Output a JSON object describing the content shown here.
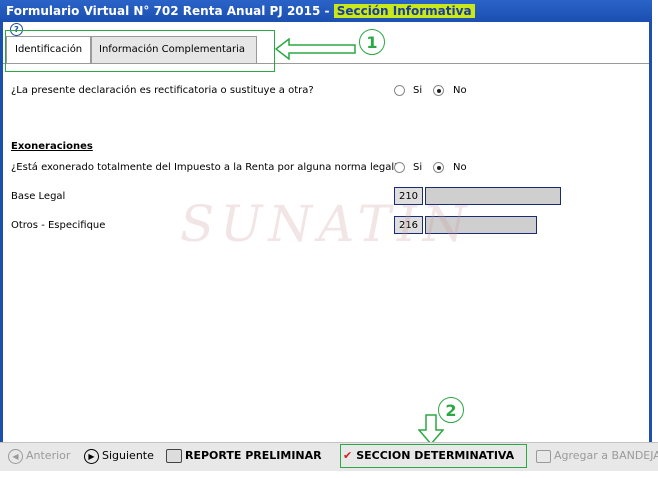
{
  "window": {
    "title_prefix": "Formulario Virtual N° 702 Renta Anual PJ 2015 - ",
    "title_highlight": "Sección Informativa"
  },
  "help_icon": "question-icon",
  "tabs": [
    {
      "label": "Identificación",
      "active": true
    },
    {
      "label": "Información Complementaria",
      "active": false
    }
  ],
  "callouts": {
    "one": "1",
    "two": "2"
  },
  "rectificatoria": {
    "question": "¿La presente declaración es rectificatoria o sustituye a otra?",
    "options": [
      {
        "label": "Si",
        "selected": false
      },
      {
        "label": "No",
        "selected": true
      }
    ]
  },
  "exoneraciones": {
    "heading": "Exoneraciones",
    "question": "¿Está exonerado totalmente del Impuesto a la Renta por alguna norma legal?",
    "options": [
      {
        "label": "Si",
        "selected": false
      },
      {
        "label": "No",
        "selected": true
      }
    ]
  },
  "fields": [
    {
      "label": "Base Legal",
      "code": "210",
      "value": ""
    },
    {
      "label": "Otros - Especifique",
      "code": "216",
      "value": ""
    }
  ],
  "watermark": "SUNATIN",
  "toolbar": {
    "anterior": "Anterior",
    "siguiente": "Siguiente",
    "reporte": "REPORTE PRELIMINAR",
    "seccion": "SECCION DETERMINATIVA",
    "agregar": "Agregar a BANDEJA"
  },
  "colors": {
    "title_bar": "#1b4fb0",
    "highlight": "#c9e81a",
    "annotation_green": "#2aa843"
  }
}
